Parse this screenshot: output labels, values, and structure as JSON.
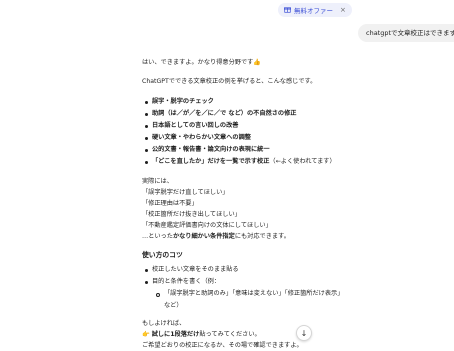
{
  "header": {
    "offer_pill": {
      "icon": "gift-icon",
      "label": "無料オファー",
      "close": "×",
      "accent": "#3c4fd6",
      "background": "#eef0fb"
    }
  },
  "chat": {
    "user_message": "chatgptで文章校正はできますか",
    "assistant": {
      "intro": "はい、できますよ。かなり得意分野です👍",
      "lead": "ChatGPTでできる文章校正の例を挙げると、こんな感じです。",
      "capabilities": [
        {
          "text": "誤字・脱字のチェック",
          "note": ""
        },
        {
          "text": "助詞（は／が／を／に／で など）の不自然さの修正",
          "note": ""
        },
        {
          "text": "日本語としての言い回しの改善",
          "note": ""
        },
        {
          "text": "硬い文章・やわらかい文章への調整",
          "note": ""
        },
        {
          "text": "公的文書・報告書・論文向けの表現に統一",
          "note": ""
        },
        {
          "text": "「どこを直したか」だけを一覧で示す校正",
          "note": "（←よく使われてます）"
        }
      ],
      "examples_intro": "実際には、",
      "examples": [
        "「誤字脱字だけ直してほしい」",
        "「修正理由は不要」",
        "「校正箇所だけ抜き出してほしい」",
        "「不動産鑑定評価書向けの文体にしてほしい」"
      ],
      "examples_outro_pre": "…といった",
      "examples_outro_bold": "かなり細かい条件指定",
      "examples_outro_post": "にも対応できます。",
      "tips_heading": "使い方のコツ",
      "tips": [
        "校正したい文章をそのまま貼る",
        "目的と条件を書く（例："
      ],
      "tip_example": "「誤字脱字と助詞のみ」「意味は変えない」「修正箇所だけ表示」など）",
      "closing_pre": "もしよければ、",
      "closing_icon": "pointing-hand-icon",
      "closing_icon_glyph": "👉",
      "closing_bold": "試しに1段落だけ",
      "closing_post": "貼ってみてください。",
      "closing_last": "ご希望どおりの校正になるか、その場で確認できますよ。"
    }
  },
  "scroll_button": {
    "icon": "arrow-down-icon",
    "glyph": "↓"
  }
}
